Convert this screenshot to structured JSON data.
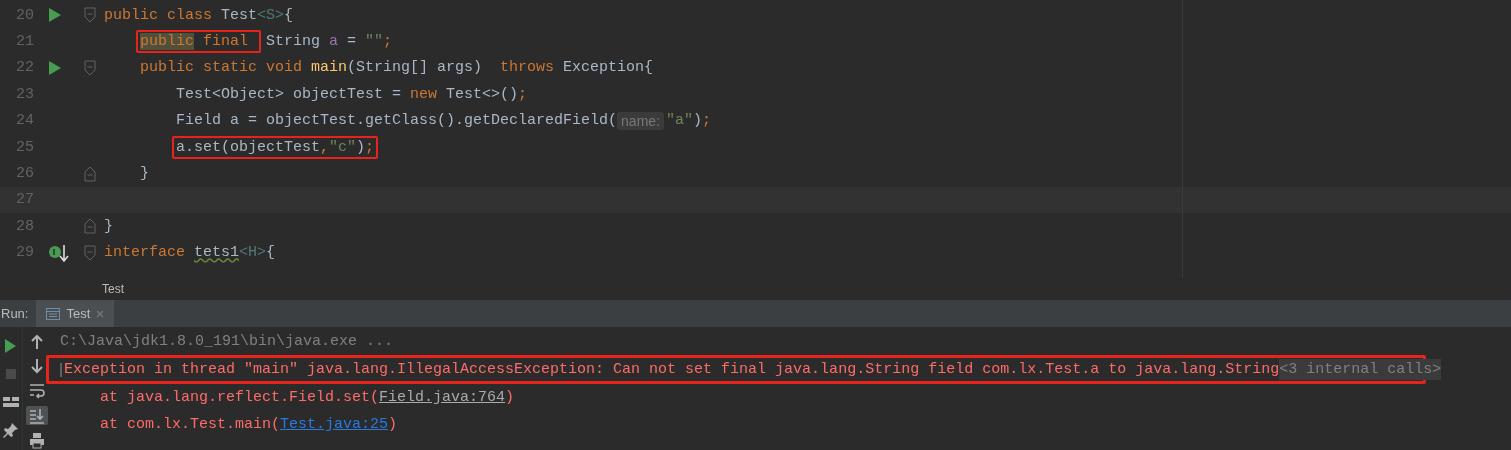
{
  "editor": {
    "lines": [
      {
        "number": "20",
        "gutter": {
          "kind": "run"
        },
        "fold": {
          "kind": "start"
        },
        "tokens": [
          {
            "kind": "kw",
            "text": "public class "
          },
          {
            "kind": "plain",
            "text": "Test"
          },
          {
            "kind": "tparam",
            "text": "<S>"
          },
          {
            "kind": "plain",
            "text": "{"
          }
        ],
        "children": [
          {
            "number": "21",
            "tokens": [
              {
                "kind": "box",
                "tokens": [
                  {
                    "kind": "kw-usage",
                    "text": "public"
                  },
                  {
                    "kind": "kw",
                    "text": " final "
                  }
                ]
              },
              {
                "kind": "plain",
                "text": " String "
              },
              {
                "kind": "field",
                "text": "a"
              },
              {
                "kind": "plain",
                "text": " = "
              },
              {
                "kind": "str",
                "text": "\"\""
              },
              {
                "kind": "kw",
                "text": ";"
              }
            ]
          },
          {
            "number": "22",
            "gutter": {
              "kind": "run"
            },
            "fold": {
              "kind": "start"
            },
            "tokens": [
              {
                "kind": "kw",
                "text": "public static void "
              },
              {
                "kind": "fn",
                "text": "main"
              },
              {
                "kind": "plain",
                "text": "(String[] args)  "
              },
              {
                "kind": "kw",
                "text": "throws "
              },
              {
                "kind": "plain",
                "text": "Exception{"
              }
            ],
            "children": [
              {
                "number": "23",
                "tokens": [
                  {
                    "kind": "plain",
                    "text": "Test<Object> objectTest = "
                  },
                  {
                    "kind": "kw",
                    "text": "new "
                  },
                  {
                    "kind": "plain",
                    "text": "Test<>()"
                  },
                  {
                    "kind": "kw",
                    "text": ";"
                  }
                ]
              },
              {
                "number": "24",
                "tokens": [
                  {
                    "kind": "plain",
                    "text": "Field a = objectTest.getClass().getDeclaredField("
                  },
                  {
                    "kind": "hint",
                    "text": "name:"
                  },
                  {
                    "kind": "str",
                    "text": "\"a\""
                  },
                  {
                    "kind": "plain",
                    "text": ")"
                  },
                  {
                    "kind": "kw",
                    "text": ";"
                  }
                ]
              },
              {
                "number": "25",
                "tokens": [
                  {
                    "kind": "box",
                    "tokens": [
                      {
                        "kind": "plain",
                        "text": "a.set(objectTest"
                      },
                      {
                        "kind": "kw",
                        "text": ","
                      },
                      {
                        "kind": "str",
                        "text": "\"c\""
                      },
                      {
                        "kind": "plain",
                        "text": ")"
                      },
                      {
                        "kind": "kw",
                        "text": ";"
                      }
                    ]
                  }
                ]
              }
            ]
          },
          {
            "number": "26",
            "fold": {
              "kind": "end"
            },
            "tokens": [
              {
                "kind": "plain",
                "text": "}"
              }
            ]
          }
        ]
      },
      {
        "number": "27",
        "current": true
      },
      {
        "number": "28",
        "fold": {
          "kind": "end"
        },
        "tokens": [
          {
            "kind": "plain",
            "text": "}"
          }
        ]
      },
      {
        "number": "29",
        "gutter": {
          "kind": "implemented"
        },
        "fold": {
          "kind": "start"
        },
        "tokens": [
          {
            "kind": "kw",
            "text": "interface "
          },
          {
            "kind": "plain-typo",
            "text": "tets1"
          },
          {
            "kind": "tparam",
            "text": "<H>"
          },
          {
            "kind": "plain",
            "text": "{"
          }
        ]
      }
    ]
  },
  "breadcrumb": "Test",
  "run_panel": {
    "label": "Run:",
    "tabs": [
      {
        "label": "Test",
        "selected": true
      }
    ],
    "left_tools": [
      {
        "kind": "run"
      },
      {
        "kind": "stop"
      },
      {
        "kind": "layout"
      },
      {
        "kind": "pin"
      }
    ],
    "right_tools": [
      {
        "kind": "up",
        "selected": false
      },
      {
        "kind": "down",
        "selected": false
      },
      {
        "kind": "wrap",
        "selected": false
      },
      {
        "kind": "scroll-end",
        "selected": true
      },
      {
        "kind": "print",
        "selected": false
      }
    ],
    "console": [
      {
        "kind": "command",
        "parts": [
          {
            "kind": "text",
            "text": "C:\\Java\\jdk1.8.0_191\\bin\\java.exe ..."
          }
        ]
      },
      {
        "kind": "error",
        "boxed": true,
        "fold": true,
        "parts": [
          {
            "kind": "text",
            "text": "Exception in thread \"main\" java.lang.IllegalAccessException: Can not set final java.lang.String field com.lx.Test.a to java.lang.String"
          },
          {
            "kind": "folded",
            "text": "<3 internal calls>"
          }
        ]
      },
      {
        "kind": "error",
        "indent": true,
        "parts": [
          {
            "kind": "text",
            "text": "at java.lang.reflect.Field.set("
          },
          {
            "kind": "library-link",
            "text": "Field.java:764"
          },
          {
            "kind": "text",
            "text": ")"
          }
        ]
      },
      {
        "kind": "error",
        "indent": true,
        "parts": [
          {
            "kind": "text",
            "text": "at com.lx.Test.main("
          },
          {
            "kind": "link",
            "text": "Test.java:25"
          },
          {
            "kind": "text",
            "text": ")"
          }
        ]
      }
    ]
  }
}
